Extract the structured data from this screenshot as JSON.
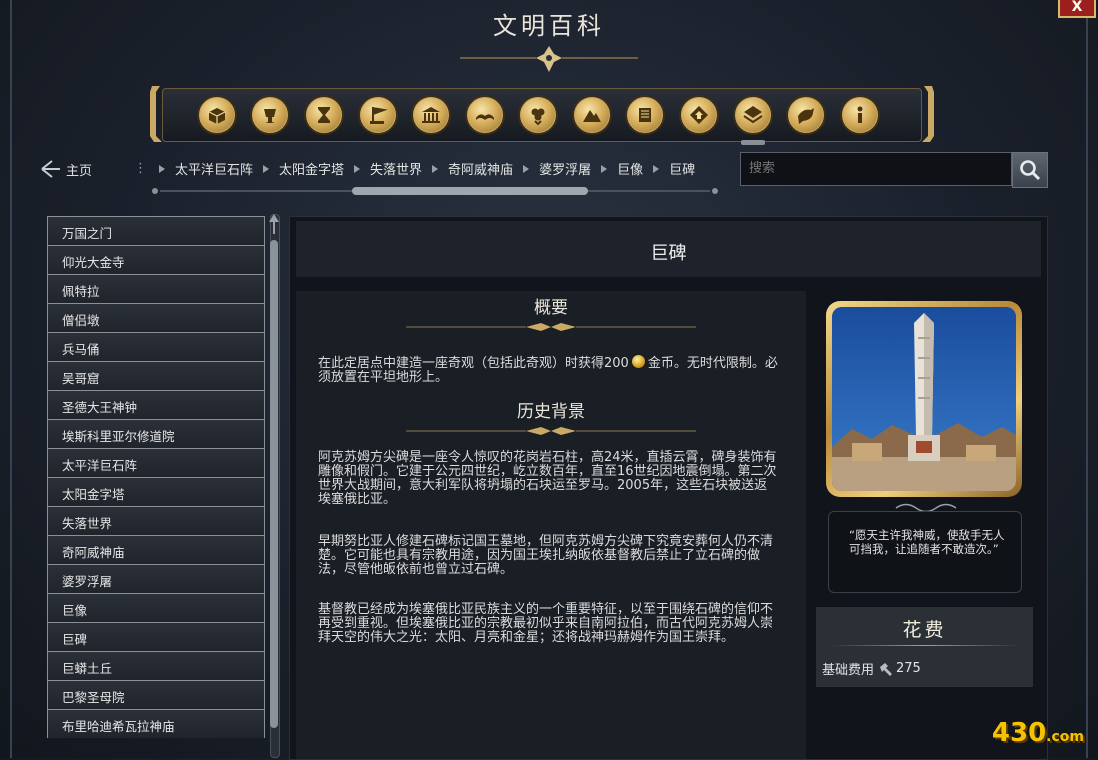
{
  "window": {
    "title": "文明百科",
    "close_label": "X"
  },
  "icon_bar": {
    "icons": [
      {
        "name": "civilizations-icon"
      },
      {
        "name": "leaders-icon"
      },
      {
        "name": "hourglass-icon"
      },
      {
        "name": "city-states-icon"
      },
      {
        "name": "buildings-icon"
      },
      {
        "name": "book-icon"
      },
      {
        "name": "units-icon"
      },
      {
        "name": "terrain-icon"
      },
      {
        "name": "wonders-icon"
      },
      {
        "name": "resources-icon"
      },
      {
        "name": "improvements-icon"
      },
      {
        "name": "religion-icon"
      },
      {
        "name": "info-icon"
      }
    ],
    "active_index": 10
  },
  "nav": {
    "home_label": "主页",
    "breadcrumbs": [
      "太平洋巨石阵",
      "太阳金字塔",
      "失落世界",
      "奇阿威神庙",
      "婆罗浮屠",
      "巨像",
      "巨碑"
    ]
  },
  "search": {
    "placeholder": "搜索"
  },
  "sidebar": {
    "items": [
      "万国之门",
      "仰光大金寺",
      "佩特拉",
      "僧侣墩",
      "兵马俑",
      "吴哥窟",
      "圣德大王神钟",
      "埃斯科里亚尔修道院",
      "太平洋巨石阵",
      "太阳金字塔",
      "失落世界",
      "奇阿威神庙",
      "婆罗浮屠",
      "巨像",
      "巨碑",
      "巨蟒土丘",
      "巴黎圣母院",
      "布里哈迪希瓦拉神庙"
    ]
  },
  "article": {
    "title": "巨碑",
    "overview_heading": "概要",
    "overview_pre": "在此定居点中建造一座奇观（包括此奇观）时获得200",
    "overview_post": "金币。无时代限制。必须放置在平坦地形上。",
    "history_heading": "历史背景",
    "history_p1": "阿克苏姆方尖碑是一座令人惊叹的花岗岩石柱，高24米，直插云霄，碑身装饰有雕像和假门。它建于公元四世纪，屹立数百年，直至16世纪因地震倒塌。第二次世界大战期间，意大利军队将坍塌的石块运至罗马。2005年，这些石块被送返埃塞俄比亚。",
    "history_p2": "早期努比亚人修建石碑标记国王墓地，但阿克苏姆方尖碑下究竟安葬何人仍不清楚。它可能也具有宗教用途，因为国王埃扎纳皈依基督教后禁止了立石碑的做法，尽管他皈依前也曾立过石碑。",
    "history_p3": "基督教已经成为埃塞俄比亚民族主义的一个重要特征，以至于围绕石碑的信仰不再受到重视。但埃塞俄比亚的宗教最初似乎来自南阿拉伯，而古代阿克苏姆人崇拜天空的伟大之光：太阳、月亮和金星；还将战神玛赫姆作为国王崇拜。"
  },
  "sidebar_panel": {
    "quote": "“愿天主许我神威，使敌手无人可挡我，让追随者不敢造次。”",
    "cost_heading": "花费",
    "base_cost_label": "基础费用",
    "base_cost_value": "275"
  },
  "watermark": {
    "main": "430",
    "suffix": ".com"
  }
}
